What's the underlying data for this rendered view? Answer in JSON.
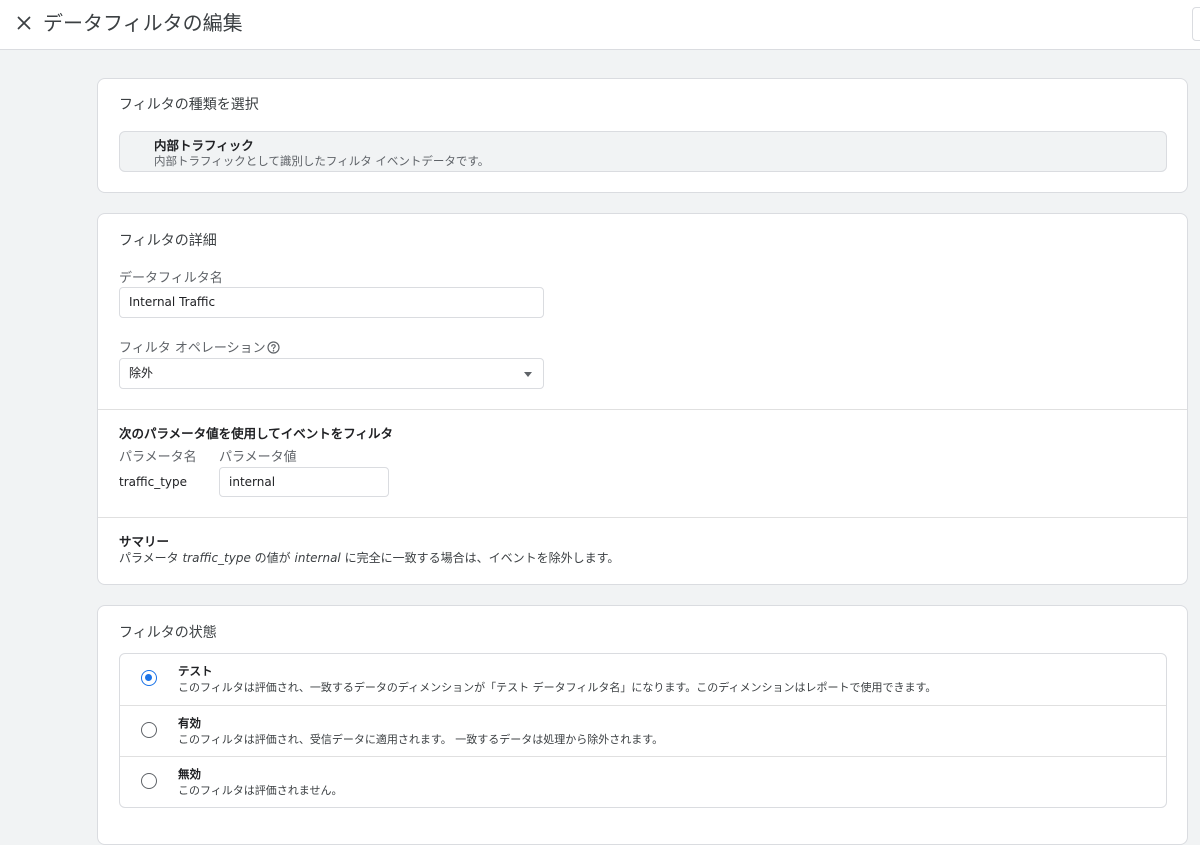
{
  "header": {
    "title": "データフィルタの編集",
    "close_icon": "close-icon"
  },
  "filter_type": {
    "section_title": "フィルタの種類を選択",
    "selected_name": "内部トラフィック",
    "selected_desc": "内部トラフィックとして識別したフィルタ イベントデータです。"
  },
  "details": {
    "section_title": "フィルタの詳細",
    "name_label": "データフィルタ名",
    "name_value": "Internal Traffic",
    "operation_label": "フィルタ オペレーション",
    "operation_help_icon": "help-circle-icon",
    "operation_value": "除外",
    "param_section_title": "次のパラメータ値を使用してイベントをフィルタ",
    "param_name_header": "パラメータ名",
    "param_value_header": "パラメータ値",
    "param_name": "traffic_type",
    "param_value": "internal",
    "summary_title": "サマリー",
    "summary_part1": "パラメータ ",
    "summary_param": "traffic_type",
    "summary_part2": " の値が ",
    "summary_value": "internal",
    "summary_part3": " に完全に一致する場合は、イベントを除外します。"
  },
  "status": {
    "section_title": "フィルタの状態",
    "options": [
      {
        "name": "テスト",
        "desc": "このフィルタは評価され、一致するデータのディメンションが「テスト データフィルタ名」になります。このディメンションはレポートで使用できます。",
        "checked": true
      },
      {
        "name": "有効",
        "desc": "このフィルタは評価され、受信データに適用されます。 一致するデータは処理から除外されます。",
        "checked": false
      },
      {
        "name": "無効",
        "desc": "このフィルタは評価されません。",
        "checked": false
      }
    ]
  },
  "colors": {
    "accent": "#1a73e8",
    "background": "#f1f3f4",
    "card": "#ffffff",
    "border": "#dadce0"
  }
}
